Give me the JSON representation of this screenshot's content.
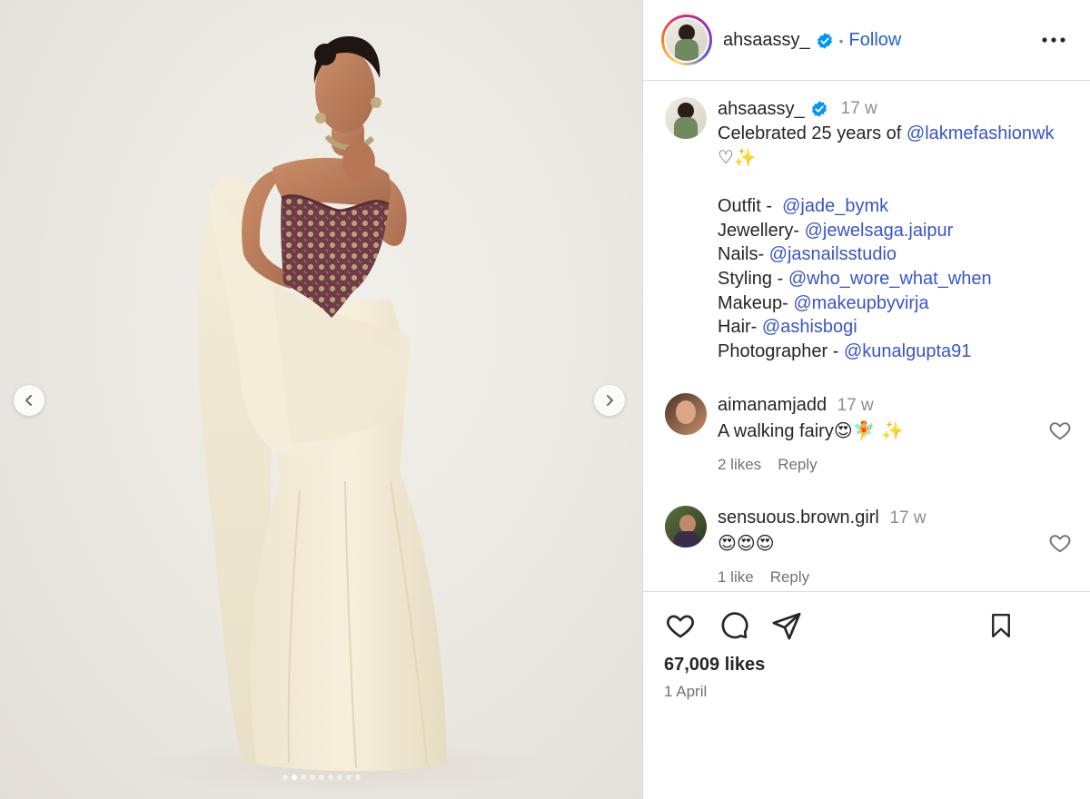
{
  "post": {
    "username": "ahsaassy_",
    "verified": true,
    "separator": "•",
    "follow_label": "Follow",
    "more_icon": "more-horizontal-icon"
  },
  "caption": {
    "username": "ahsaassy_",
    "time": "17 w",
    "line1_text": "Celebrated 25 years of ",
    "line1_mention": "@lakmefashionwk",
    "emojis": "♡✨",
    "credits": [
      {
        "label": "Outfit -  ",
        "mention": "@jade_bymk"
      },
      {
        "label": "Jewellery- ",
        "mention": "@jewelsaga.jaipur"
      },
      {
        "label": "Nails- ",
        "mention": "@jasnailsstudio"
      },
      {
        "label": "Styling - ",
        "mention": "@who_wore_what_when"
      },
      {
        "label": "Makeup- ",
        "mention": "@makeupbyvirja"
      },
      {
        "label": "Hair- ",
        "mention": "@ashisbogi"
      },
      {
        "label": "Photographer - ",
        "mention": "@kunalgupta91"
      }
    ]
  },
  "comments": [
    {
      "username": "aimanamjadd",
      "time": "17 w",
      "text": "A walking fairy",
      "emojis": "😍🧚 ✨",
      "likes": "2 likes",
      "reply": "Reply"
    },
    {
      "username": "sensuous.brown.girl",
      "time": "17 w",
      "text": "",
      "emojis": "😍😍😍",
      "likes": "1 like",
      "reply": "Reply"
    }
  ],
  "footer": {
    "likes": "67,009 likes",
    "date": "1 April"
  },
  "carousel": {
    "slide_count": 9,
    "active_index": 1
  },
  "colors": {
    "link": "#3a55c9",
    "follow": "#2561d4",
    "verified": "#0095f6",
    "muted": "#737373"
  }
}
